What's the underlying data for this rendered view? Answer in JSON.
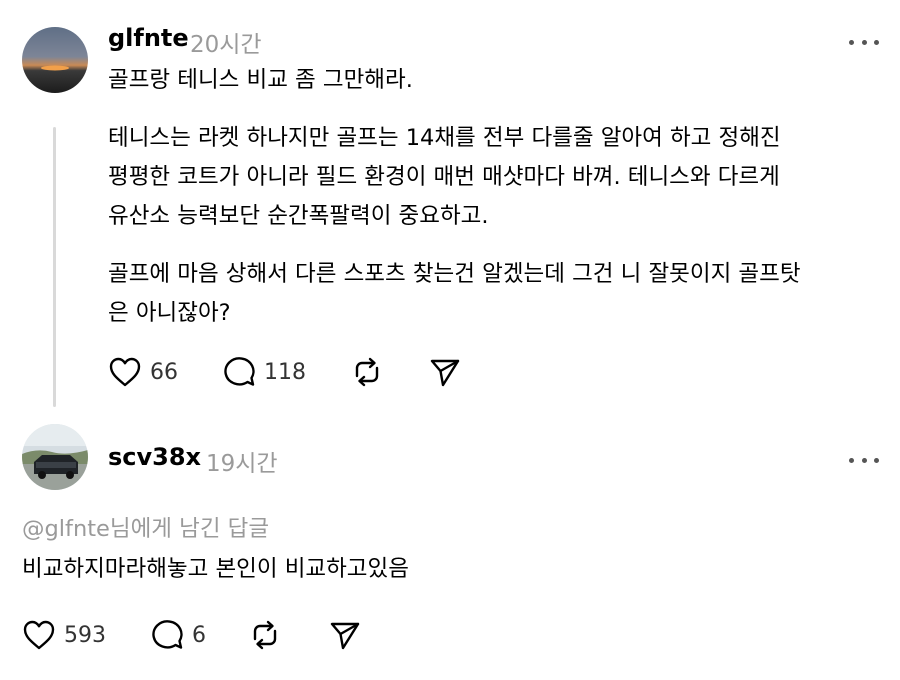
{
  "post": {
    "username": "glfnte",
    "timestamp": "20시간",
    "title": "골프랑 테니스 비교 좀 그만해라.",
    "paragraph1": [
      "테니스는 라켓 하나지만 골프는 14채를 전부 다를줄 알아여 하고 정해진",
      "평평한 코트가 아니라 필드 환경이 매번 매샷마다 바껴. 테니스와 다르게",
      "유산소 능력보단 순간폭팔력이 중요하고."
    ],
    "paragraph2": [
      "골프에 마음 상해서 다른 스포츠 찾는건 알겠는데 그건 니 잘못이지 골프탓",
      "은 아니잖아?"
    ],
    "likes": "66",
    "comments": "118"
  },
  "reply": {
    "username": "scv38x",
    "timestamp": "19시간",
    "reply_to": "@glfnte님에게 남긴 답글",
    "text": "비교하지마라해놓고 본인이 비교하고있음",
    "likes": "593",
    "comments": "6"
  },
  "icons": {
    "more": "more-horizontal-icon",
    "like": "heart-icon",
    "comment": "speech-bubble-icon",
    "repost": "repost-arrows-icon",
    "share": "paper-plane-icon"
  },
  "colors": {
    "text": "#000000",
    "muted": "#9a9a9a",
    "icon": "#000000",
    "thread_line": "#d9d9d9"
  }
}
